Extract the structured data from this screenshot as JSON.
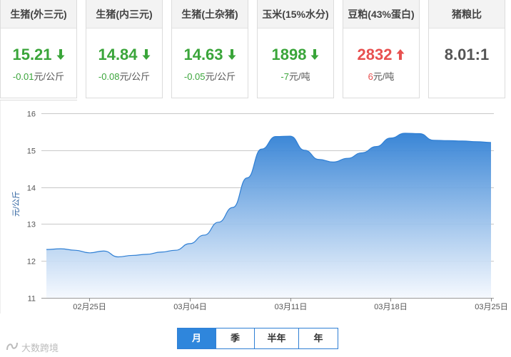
{
  "cards": [
    {
      "title": "生猪(外三元)",
      "price": "15.21",
      "trend": "down",
      "change": "-0.01",
      "unit": "元/公斤"
    },
    {
      "title": "生猪(内三元)",
      "price": "14.84",
      "trend": "down",
      "change": "-0.08",
      "unit": "元/公斤"
    },
    {
      "title": "生猪(土杂猪)",
      "price": "14.63",
      "trend": "down",
      "change": "-0.05",
      "unit": "元/公斤"
    },
    {
      "title": "玉米(15%水分)",
      "price": "1898",
      "trend": "down",
      "change": "-7",
      "unit": "元/吨"
    },
    {
      "title": "豆粕(43%蛋白)",
      "price": "2832",
      "trend": "up",
      "change": "6",
      "unit": "元/吨"
    },
    {
      "title": "猪粮比",
      "price": "8.01:1",
      "trend": "flat",
      "change": "",
      "unit": ""
    }
  ],
  "colors": {
    "down": "#3aa53a",
    "up": "#e8504f",
    "fill_top": "#2f7fd4",
    "fill_bottom": "#f4f8fe",
    "line": "#2f7fd4"
  },
  "chart_data": {
    "type": "area",
    "ylabel": "元/公斤",
    "ylim": [
      11,
      16
    ],
    "yticks": [
      11,
      12,
      13,
      14,
      15,
      16
    ],
    "grid": true,
    "x": [
      "02-22",
      "02-23",
      "02-24",
      "02-25",
      "02-26",
      "02-27",
      "02-28",
      "03-01",
      "03-02",
      "03-03",
      "03-04",
      "03-05",
      "03-06",
      "03-07",
      "03-08",
      "03-09",
      "03-10",
      "03-11",
      "03-12",
      "03-13",
      "03-14",
      "03-15",
      "03-16",
      "03-17",
      "03-18",
      "03-19",
      "03-20",
      "03-21",
      "03-22",
      "03-23",
      "03-24",
      "03-25"
    ],
    "values": [
      12.31,
      12.33,
      12.29,
      12.22,
      12.27,
      12.11,
      12.15,
      12.18,
      12.24,
      12.29,
      12.47,
      12.7,
      13.05,
      13.45,
      14.25,
      15.03,
      15.37,
      15.38,
      15.0,
      14.75,
      14.68,
      14.78,
      14.93,
      15.1,
      15.33,
      15.46,
      15.45,
      15.27,
      15.26,
      15.25,
      15.23,
      15.21
    ],
    "tick_labels": [
      {
        "index": 3,
        "label": "02月25日"
      },
      {
        "index": 10,
        "label": "03月04日"
      },
      {
        "index": 17,
        "label": "03月11日"
      },
      {
        "index": 24,
        "label": "03月18日"
      },
      {
        "index": 31,
        "label": "03月25日"
      }
    ]
  },
  "tabs": [
    {
      "label": "月",
      "active": true
    },
    {
      "label": "季",
      "active": false
    },
    {
      "label": "半年",
      "active": false
    },
    {
      "label": "年",
      "active": false
    }
  ],
  "watermark": "大数跨境"
}
